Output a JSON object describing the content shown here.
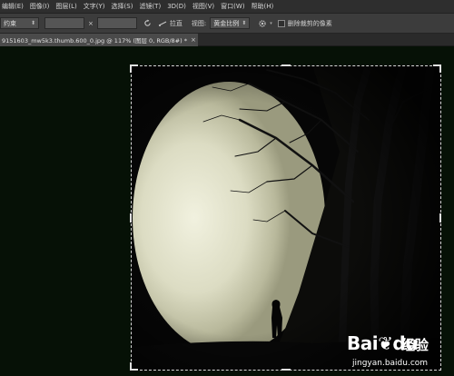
{
  "menubar": {
    "items": [
      {
        "label": "编辑(E)"
      },
      {
        "label": "图像(I)"
      },
      {
        "label": "图层(L)"
      },
      {
        "label": "文字(Y)"
      },
      {
        "label": "选择(S)"
      },
      {
        "label": "滤镜(T)"
      },
      {
        "label": "3D(D)"
      },
      {
        "label": "视图(V)"
      },
      {
        "label": "窗口(W)"
      },
      {
        "label": "帮助(H)"
      }
    ]
  },
  "options": {
    "ratio_dropdown": "约束",
    "swap_symbol": "×",
    "straighten_label": "拉直",
    "view_label": "视图:",
    "view_dropdown": "黄金比例",
    "delete_cropped_label": "删除裁剪的像素"
  },
  "document_tab": {
    "title": "9151603_mw5k3.thumb.600_0.jpg @ 117% (图层 0, RGB/8#) *",
    "close": "×"
  },
  "watermark": {
    "logo_left": "Bai",
    "logo_right": "du",
    "logo_suffix": "经验",
    "url": "jingyan.baidu.com"
  },
  "colors": {
    "canvas_bg": "#061106",
    "toolbar_bg": "#3c3c3c",
    "menubar_bg": "#2e2e2e"
  }
}
